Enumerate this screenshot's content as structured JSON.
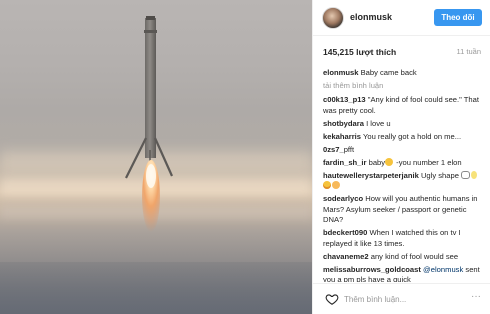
{
  "post": {
    "username": "elonmusk",
    "follow_label": "Theo dõi",
    "likes": "145,215 lượt thích",
    "time": "11 tuần"
  },
  "caption": {
    "user": "elonmusk",
    "text": "Baby came back"
  },
  "load_more": "tải thêm bình luận",
  "comments": [
    {
      "user": "c00k13_p13",
      "text": "\"Any kind of fool could see.\" That was pretty cool."
    },
    {
      "user": "shotbydara",
      "text": "I love u"
    },
    {
      "user": "kekaharris",
      "text": "You really got a hold on me..."
    },
    {
      "user": "0zs7_",
      "text": "pfft"
    },
    {
      "user": "fardin_sh_ir",
      "text_before": "baby",
      "text_after": " -you number 1 elon"
    },
    {
      "user": "hautewellerystarpeterjanik",
      "text": "Ugly shape"
    },
    {
      "user": "sodearlyco",
      "text": "How will you authentic humans in Mars? Asylum seeker / passport or genetic DNA?"
    },
    {
      "user": "bdeckert090",
      "text": "When I watched this on tv I replayed it like 13 times."
    },
    {
      "user": "chavaneme2",
      "text": "any kind of fool would see"
    },
    {
      "user": "melissaburrows_goldcoast",
      "mention": "@elonmusk",
      "text": "sent you a pm pls have a quick"
    }
  ],
  "footer": {
    "comment_placeholder": "Thêm bình luận...",
    "more_label": "···"
  },
  "colors": {
    "accent": "#3897f0",
    "text": "#262626",
    "muted": "#999999"
  },
  "icons": [
    "heart-icon",
    "more-options-icon",
    "emoji-icon"
  ]
}
